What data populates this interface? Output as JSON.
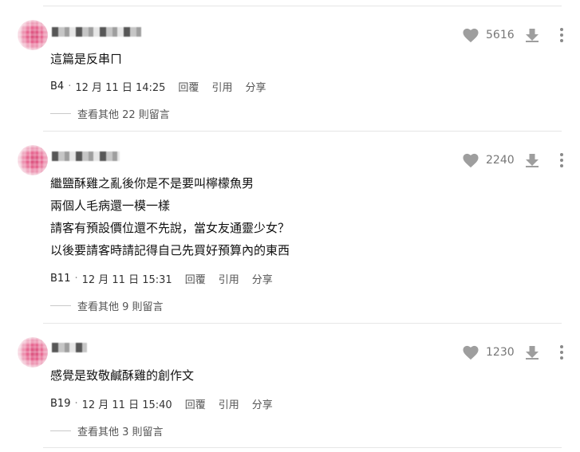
{
  "icons": {
    "like": "heart-icon",
    "dislike": "arrow-down-icon",
    "more": "more-vertical-icon"
  },
  "colors": {
    "icon_gray": "#9e9e9e",
    "text_muted": "#555555",
    "divider": "#e6e6e6"
  },
  "comments": [
    {
      "text_lines": [
        "這篇是反串ㄇ"
      ],
      "likes": "5616",
      "floor": "B4",
      "separator": "·",
      "timestamp": "12 月 11 日 14:25",
      "reply_label": "回覆",
      "quote_label": "引用",
      "share_label": "分享",
      "more_replies": "查看其他 22 則留言"
    },
    {
      "text_lines": [
        "繼鹽酥雞之亂後你是不是要叫檸檬魚男",
        "兩個人毛病還一模一樣",
        "請客有預設價位還不先說，當女友通靈少女？",
        "以後要請客時請記得自己先買好預算內的東西"
      ],
      "likes": "2240",
      "floor": "B11",
      "separator": "·",
      "timestamp": "12 月 11 日 15:31",
      "reply_label": "回覆",
      "quote_label": "引用",
      "share_label": "分享",
      "more_replies": "查看其他 9 則留言"
    },
    {
      "text_lines": [
        "感覺是致敬鹹酥雞的創作文"
      ],
      "likes": "1230",
      "floor": "B19",
      "separator": "·",
      "timestamp": "12 月 11 日 15:40",
      "reply_label": "回覆",
      "quote_label": "引用",
      "share_label": "分享",
      "more_replies": "查看其他 3 則留言"
    }
  ]
}
